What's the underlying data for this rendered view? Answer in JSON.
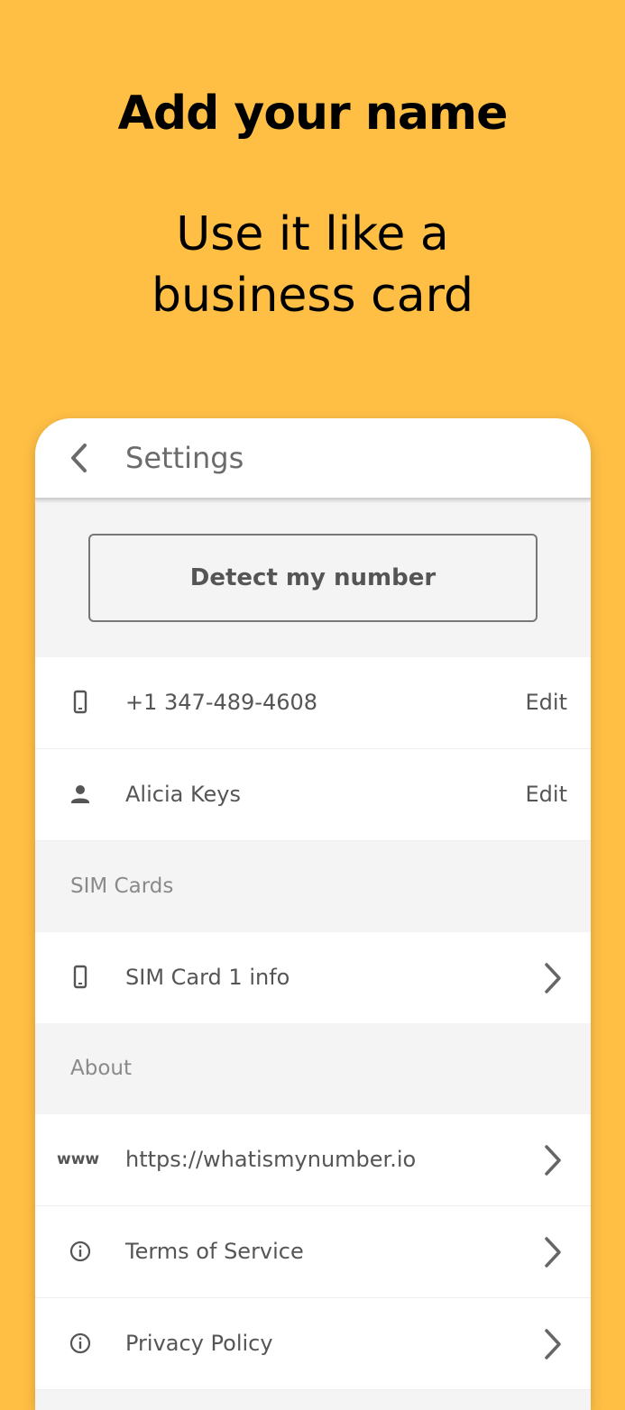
{
  "headline": "Add your name",
  "subline": [
    "Use it like a",
    "business card"
  ],
  "appbar": {
    "title": "Settings",
    "back_icon": "chevron-left-icon"
  },
  "detect_button": "Detect my number",
  "rows": {
    "phone": {
      "icon": "phone-icon",
      "value": "+1 347-489-4608",
      "action": "Edit"
    },
    "name": {
      "icon": "person-icon",
      "value": "Alicia Keys",
      "action": "Edit"
    }
  },
  "sections": {
    "sim": "SIM Cards",
    "about": "About"
  },
  "sim_row": {
    "icon": "phone-icon",
    "label": "SIM Card 1 info"
  },
  "about_rows": {
    "website": {
      "icon_text": "www",
      "label": "https://whatismynumber.io"
    },
    "terms": {
      "icon": "info-icon",
      "label": "Terms of Service"
    },
    "privacy": {
      "icon": "info-icon",
      "label": "Privacy Policy"
    }
  },
  "colors": {
    "background": "#FFBF45",
    "text": "#555555",
    "panel": "#F4F4F4"
  }
}
